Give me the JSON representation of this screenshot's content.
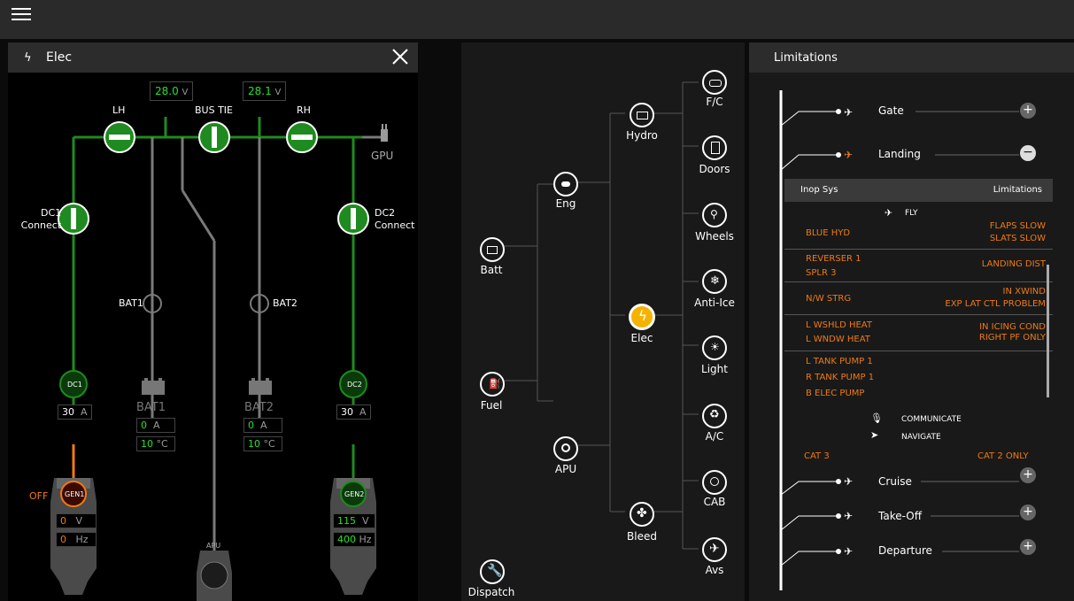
{
  "topbar": {
    "menu_icon": "hamburger-menu-icon"
  },
  "elec_panel": {
    "title": "Elec",
    "close_icon": "close-icon",
    "voltage_left": "28.0",
    "voltage_right": "28.1",
    "voltage_unit": "V",
    "bus_labels": {
      "lh": "LH",
      "bus_tie": "BUS TIE",
      "rh": "RH",
      "gpu": "GPU"
    },
    "dc1_connect": [
      "DC1",
      "Connect"
    ],
    "dc2_connect": [
      "DC2",
      "Connect"
    ],
    "bat1_label": "BAT1",
    "bat2_label": "BAT2",
    "dc1_label": "DC1",
    "dc2_label": "DC2",
    "dc1_current": "30",
    "dc2_current": "30",
    "current_unit": "A",
    "bat1": {
      "name": "BAT1",
      "current": "0",
      "temp": "10",
      "temp_unit": "°C"
    },
    "bat2": {
      "name": "BAT2",
      "current": "0",
      "temp": "10",
      "temp_unit": "°C"
    },
    "gen1": {
      "name": "GEN1",
      "status": "OFF",
      "voltage": "0",
      "freq": "0"
    },
    "gen2": {
      "name": "GEN2",
      "voltage": "115",
      "freq": "400"
    },
    "voltage_unit_v": "V",
    "freq_unit": "Hz",
    "apu_label": "APU",
    "colors": {
      "green": "#28e02a",
      "orange": "#f07a12",
      "grey": "#8a8a8a"
    }
  },
  "systems_tree": {
    "root": "Batt",
    "fuel": "Fuel",
    "eng": "Eng",
    "apu": "APU",
    "hydro": "Hydro",
    "elec": "Elec",
    "bleed": "Bleed",
    "leaves": [
      "F/C",
      "Doors",
      "Wheels",
      "Anti-Ice",
      "Light",
      "A/C",
      "CAB",
      "Avs"
    ],
    "dispatch": "Dispatch",
    "active_color": "#f5b301"
  },
  "limitations": {
    "title": "Limitations",
    "phases_top": [
      {
        "name": "Gate",
        "button": "+"
      },
      {
        "name": "Landing",
        "button": "−"
      }
    ],
    "table_header": {
      "col1": "Inop Sys",
      "col2": "Limitations"
    },
    "fly_label": "FLY",
    "rows": [
      {
        "systems": [
          "BLUE HYD"
        ],
        "limits": [
          "FLAPS SLOW",
          "SLATS SLOW"
        ]
      },
      {
        "systems": [
          "REVERSER 1",
          "SPLR 3"
        ],
        "limits": [
          "LANDING DIST"
        ]
      },
      {
        "systems": [
          "N/W STRG"
        ],
        "limits": [
          "IN XWIND",
          "EXP LAT CTL PROBLEM"
        ]
      },
      {
        "systems": [
          "L WSHLD HEAT",
          "L WNDW HEAT"
        ],
        "limits": [
          "IN ICING COND",
          "RIGHT PF ONLY"
        ]
      },
      {
        "systems": [
          "L TANK PUMP 1",
          "R TANK PUMP 1",
          "B ELEC PUMP"
        ],
        "limits": []
      }
    ],
    "communicate": "COMMUNICATE",
    "navigate": "NAVIGATE",
    "cat_left": "CAT 3",
    "cat_right": "CAT 2 ONLY",
    "phases_bottom": [
      {
        "name": "Cruise",
        "button": "+"
      },
      {
        "name": "Take-Off",
        "button": "+"
      },
      {
        "name": "Departure",
        "button": "+"
      }
    ]
  }
}
